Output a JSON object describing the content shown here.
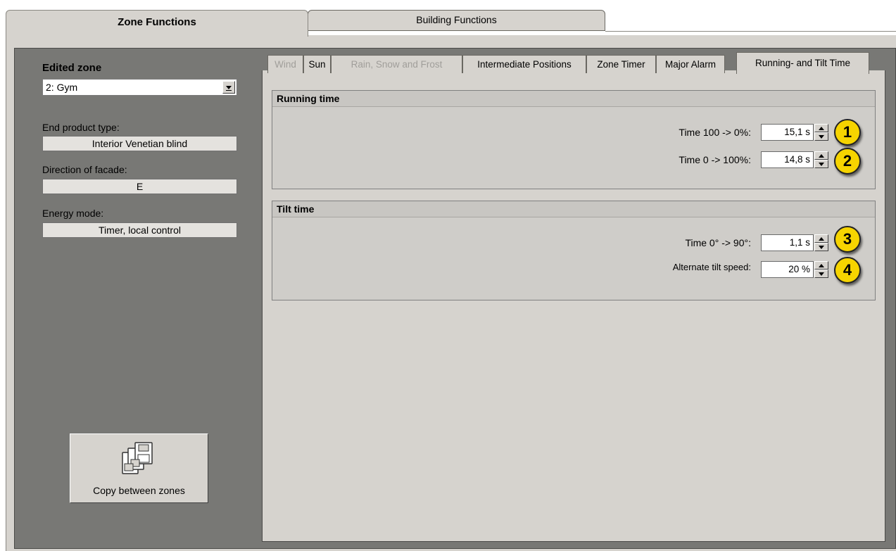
{
  "tabs": {
    "zone_functions": "Zone Functions",
    "building_functions": "Building Functions"
  },
  "left": {
    "edited_zone_label": "Edited zone",
    "edited_zone_value": "2: Gym",
    "end_product_label": "End product type:",
    "end_product_value": "Interior Venetian blind",
    "direction_label": "Direction of facade:",
    "direction_value": "E",
    "energy_label": "Energy mode:",
    "energy_value": "Timer, local control",
    "copy_button": "Copy between zones"
  },
  "subtabs": [
    {
      "label": "Wind",
      "state": "disabled"
    },
    {
      "label": "Sun",
      "state": "normal"
    },
    {
      "label": "Rain, Snow and Frost",
      "state": "disabled"
    },
    {
      "label": "Intermediate Positions",
      "state": "normal"
    },
    {
      "label": "Zone Timer",
      "state": "normal"
    },
    {
      "label": "Major Alarm",
      "state": "normal"
    },
    {
      "label": "Running- and Tilt Time",
      "state": "active"
    }
  ],
  "running_time": {
    "title": "Running time",
    "rows": [
      {
        "label": "Time 100 -> 0%:",
        "value": "15,1 s",
        "marker": "1"
      },
      {
        "label": "Time 0 -> 100%:",
        "value": "14,8 s",
        "marker": "2"
      }
    ]
  },
  "tilt_time": {
    "title": "Tilt time",
    "rows": [
      {
        "label": "Time 0° -> 90°:",
        "value": "1,1 s",
        "marker": "3"
      },
      {
        "label": "Alternate tilt speed:",
        "value": "20 %",
        "marker": "4"
      }
    ]
  },
  "colors": {
    "window_bg": "#d6d3ce",
    "dark_area": "#787875",
    "marker": "#f6d400"
  },
  "icons": {
    "copy_button_icon": "copy-floppy-disks-icon",
    "combo_dropdown": "chevron-down-icon",
    "spin_up": "arrow-up-icon",
    "spin_down": "arrow-down-icon"
  }
}
